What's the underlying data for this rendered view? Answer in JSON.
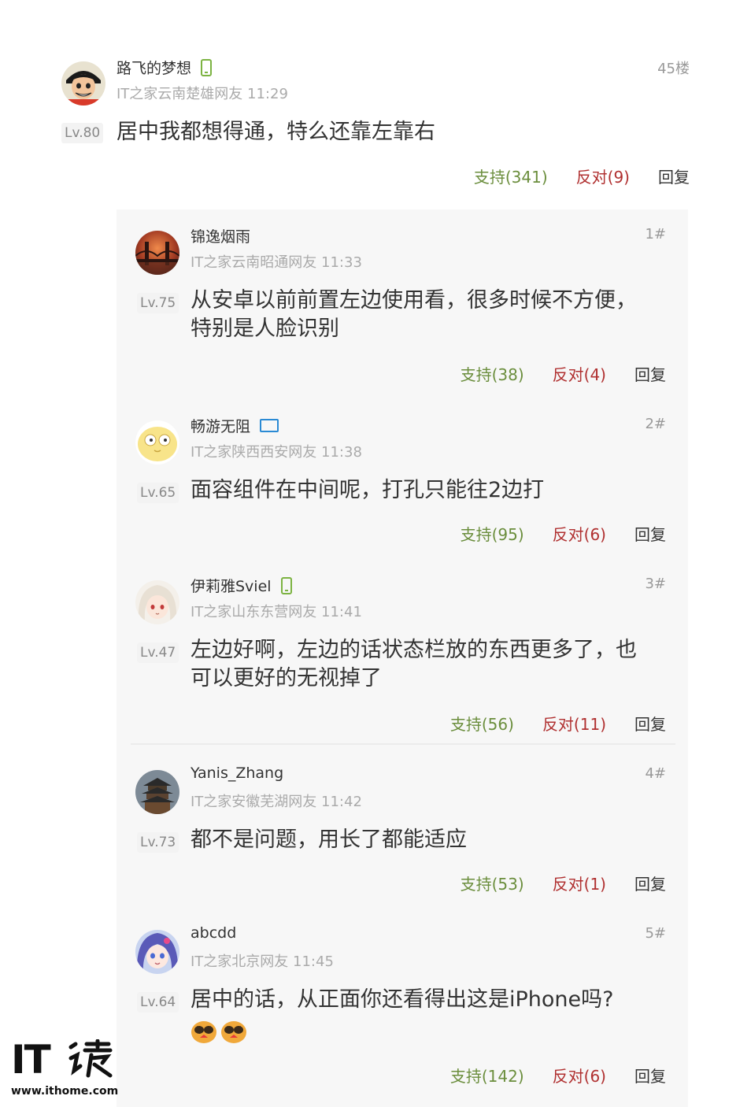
{
  "main": {
    "username": "路飞的梦想",
    "meta": "IT之家云南楚雄网友 11:29",
    "floor": "45楼",
    "level": "Lv.80",
    "text": "居中我都想得通，特么还靠左靠右",
    "support": "支持(341)",
    "oppose": "反对(9)",
    "reply": "回复"
  },
  "replies": [
    {
      "username": "锦逸烟雨",
      "meta": "IT之家云南昭通网友 11:33",
      "floor": "1#",
      "level": "Lv.75",
      "text_line1": "从安卓以前前置左边使用看，很多时候不方便，",
      "text_line2": "特别是人脸识别",
      "support": "支持(38)",
      "oppose": "反对(4)",
      "reply": "回复"
    },
    {
      "username": "畅游无阻",
      "meta": "IT之家陕西西安网友 11:38",
      "floor": "2#",
      "level": "Lv.65",
      "text_line1": "面容组件在中间呢，打孔只能往2边打",
      "support": "支持(95)",
      "oppose": "反对(6)",
      "reply": "回复"
    },
    {
      "username": "伊莉雅Sviel",
      "meta": "IT之家山东东营网友 11:41",
      "floor": "3#",
      "level": "Lv.47",
      "text_line1": "左边好啊，左边的话状态栏放的东西更多了，也",
      "text_line2": "可以更好的无视掉了",
      "support": "支持(56)",
      "oppose": "反对(11)",
      "reply": "回复"
    },
    {
      "username": "Yanis_Zhang",
      "meta": "IT之家安徽芜湖网友 11:42",
      "floor": "4#",
      "level": "Lv.73",
      "text_line1": "都不是问题，用长了都能适应",
      "support": "支持(53)",
      "oppose": "反对(1)",
      "reply": "回复"
    },
    {
      "username": "abcdd",
      "meta": "IT之家北京网友 11:45",
      "floor": "5#",
      "level": "Lv.64",
      "text_line1": "居中的话，从正面你还看得出这是iPhone吗?",
      "support": "支持(142)",
      "oppose": "反对(6)",
      "reply": "回复"
    }
  ],
  "logo": {
    "it": "IT",
    "cn": "之家",
    "url": "www.ithome.com"
  },
  "icons": {
    "mobile_badge": "mobile-phone-icon",
    "pc_badge": "pc-monitor-icon",
    "emoji": "angry-face-emoji-icon"
  },
  "colors": {
    "support": "#6b8e3d",
    "oppose": "#b03030",
    "mobile_badge": "#7cb342",
    "pc_badge": "#2a8ad4"
  }
}
